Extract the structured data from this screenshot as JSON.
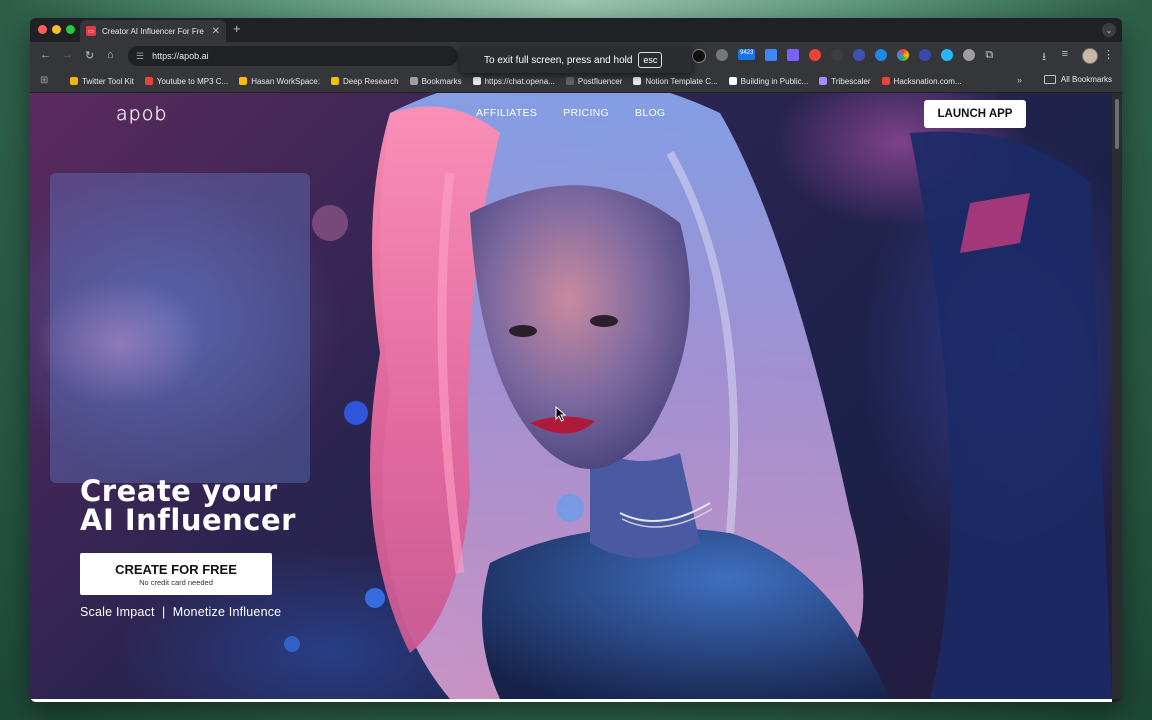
{
  "browser": {
    "tab_title": "Creator AI Influencer For Fre",
    "tab_favicon": "apob-favicon",
    "new_tab_label": "+",
    "url": "https://apob.ai",
    "fullscreen_toast": {
      "text": "To exit full screen, press and hold",
      "key": "esc"
    },
    "extension_badge": "9423"
  },
  "bookmarks": [
    {
      "label": "Twitter Tool Kit",
      "color": "#f4b400"
    },
    {
      "label": "Youtube to MP3 C...",
      "color": "#ea4335"
    },
    {
      "label": "Hasan WorkSpace:",
      "color": "#fbbc04"
    },
    {
      "label": "Deep Research",
      "color": "#fbbc04"
    },
    {
      "label": "Bookmarks",
      "color": "#9aa0a6"
    },
    {
      "label": "https://chat.opena...",
      "color": "#e8eaed"
    },
    {
      "label": "Postfluencer",
      "color": "#5f6368"
    },
    {
      "label": "Notion Template C...",
      "color": "#e8eaed"
    },
    {
      "label": "Building in Public...",
      "color": "#ffffff"
    },
    {
      "label": "Tribescaler",
      "color": "#a78bfa"
    },
    {
      "label": "Hacksnation.com...",
      "color": "#ea4335"
    }
  ],
  "bookmarks_all": "All Bookmarks",
  "site": {
    "logo": "apob",
    "nav": [
      "AFFILIATES",
      "PRICING",
      "BLOG"
    ],
    "launch_button": "LAUNCH APP",
    "hero_title_line1": "Create your",
    "hero_title_line2": "AI Influencer",
    "cta_main": "CREATE FOR FREE",
    "cta_sub": "No credit card needed",
    "tagline": "Scale Impact  |  Monetize Influence"
  }
}
